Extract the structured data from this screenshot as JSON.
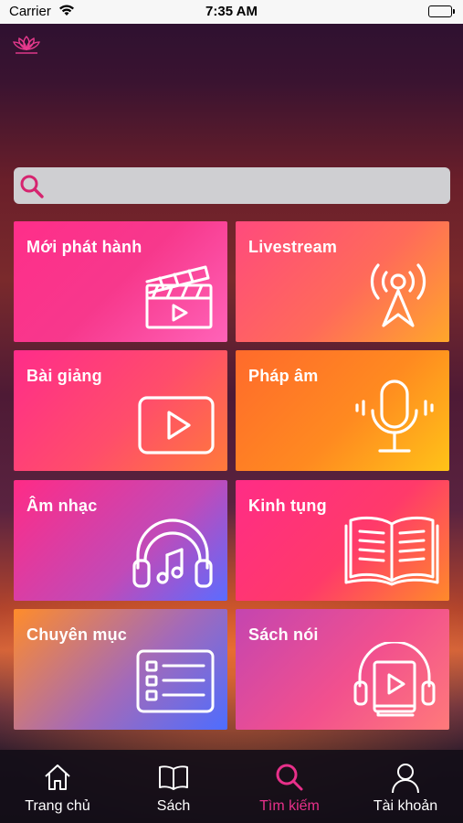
{
  "status_bar": {
    "carrier": "Carrier",
    "time": "7:35 AM"
  },
  "search": {
    "placeholder": "",
    "value": ""
  },
  "tiles": [
    {
      "label": "Mới phát hành",
      "icon": "clapperboard-icon"
    },
    {
      "label": "Livestream",
      "icon": "broadcast-tower-icon"
    },
    {
      "label": "Bài giảng",
      "icon": "video-play-icon"
    },
    {
      "label": "Pháp âm",
      "icon": "microphone-icon"
    },
    {
      "label": "Âm nhạc",
      "icon": "headphones-icon"
    },
    {
      "label": "Kinh tụng",
      "icon": "open-book-icon"
    },
    {
      "label": "Chuyên mục",
      "icon": "category-list-icon"
    },
    {
      "label": "Sách nói",
      "icon": "audiobook-icon"
    }
  ],
  "tabbar": {
    "items": [
      {
        "label": "Trang chủ",
        "icon": "home-icon"
      },
      {
        "label": "Sách",
        "icon": "book-icon"
      },
      {
        "label": "Tìm kiếm",
        "icon": "search-icon",
        "active": true
      },
      {
        "label": "Tài khoản",
        "icon": "account-icon"
      }
    ]
  },
  "colors": {
    "accent": "#e8308a",
    "search_bg": "#cfcfd2"
  }
}
